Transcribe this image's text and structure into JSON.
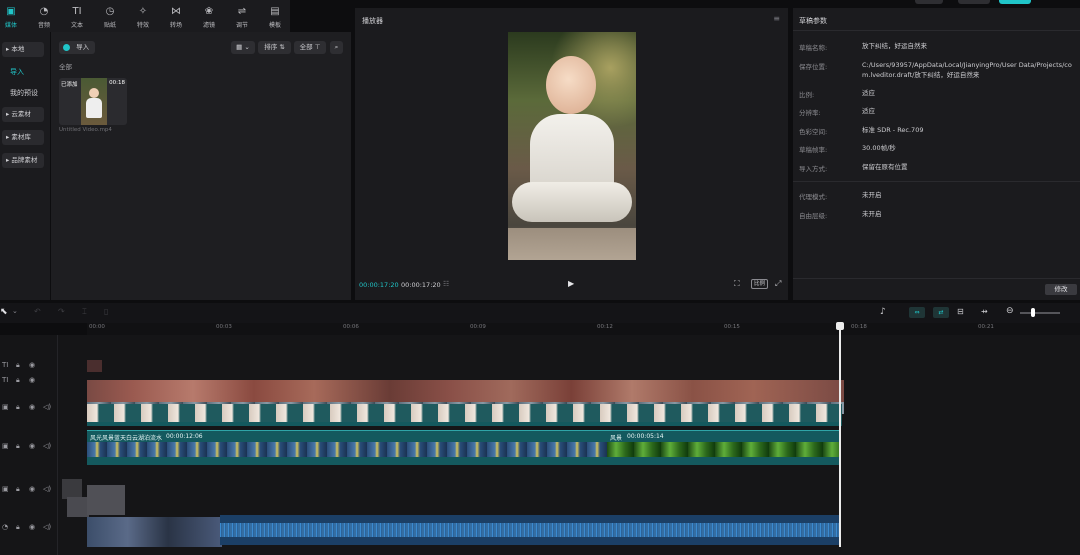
{
  "toolbar": {
    "items": [
      {
        "label": "媒体",
        "icon": "media-icon"
      },
      {
        "label": "音频",
        "icon": "audio-icon"
      },
      {
        "label": "文本",
        "icon": "text-icon"
      },
      {
        "label": "贴纸",
        "icon": "sticker-icon"
      },
      {
        "label": "特效",
        "icon": "effects-icon"
      },
      {
        "label": "转场",
        "icon": "transition-icon"
      },
      {
        "label": "滤镜",
        "icon": "filter-icon"
      },
      {
        "label": "调节",
        "icon": "adjust-icon"
      },
      {
        "label": "模板",
        "icon": "template-icon"
      }
    ]
  },
  "nav": {
    "local": "▸ 本地",
    "import": "导入",
    "presets": "我的预设",
    "cloud": "▸ 云素材",
    "library": "▸ 素材库",
    "brand": "▸ 品牌素材"
  },
  "media": {
    "import_btn": "导入",
    "sort": "排序",
    "all_btn": "全部",
    "section": "全部",
    "clip_badge": "已添加",
    "clip_duration": "00:18",
    "clip_name": "Untitled Video.mp4"
  },
  "player": {
    "title": "播放器",
    "current": "00:00:17:20",
    "total": "00:00:17:20",
    "ratio_btn": "比例"
  },
  "draft": {
    "title": "草稿参数",
    "modify": "修改",
    "rows": [
      {
        "label": "草稿名称:",
        "value": "放下纠结，好运自然来"
      },
      {
        "label": "保存位置:",
        "value": "C:/Users/93957/AppData/Local/JianyingPro/User Data/Projects/com.lveditor.draft/放下纠结，好运自然来"
      },
      {
        "label": "比例:",
        "value": "适应"
      },
      {
        "label": "分辨率:",
        "value": "适应"
      },
      {
        "label": "色彩空间:",
        "value": "标准 SDR - Rec.709"
      },
      {
        "label": "草稿帧率:",
        "value": "30.00帧/秒"
      },
      {
        "label": "导入方式:",
        "value": "保留在原有位置"
      },
      {
        "label": "代理模式:",
        "value": "未开启"
      },
      {
        "label": "自由层级:",
        "value": "未开启"
      }
    ]
  },
  "ruler": [
    "00:00",
    "00:03",
    "00:06",
    "00:09",
    "00:12",
    "00:15",
    "00:18",
    "00:21"
  ],
  "timeline": {
    "clip1_name": "风光风景蓝天白云湖泊流水",
    "clip1_dur": "00:00:12:06",
    "clip2_name": "风景",
    "clip2_dur": "00:00:05:14"
  },
  "colors": {
    "accent": "#20c5c8",
    "audio": "#1b3f66",
    "video": "#14595e"
  }
}
